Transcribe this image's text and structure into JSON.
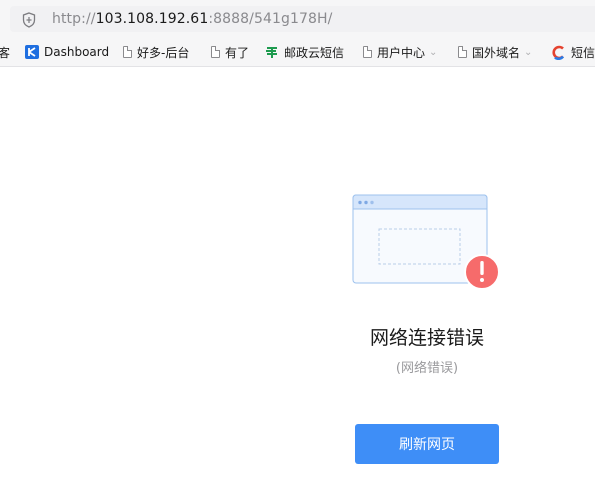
{
  "browser": {
    "url_scheme": "http://",
    "url_host": "103.108.192.61",
    "url_rest": ":8888/541g178H/"
  },
  "bookmarks": {
    "partial_first": "客",
    "items": [
      {
        "label": "Dashboard",
        "icon": "kuaidi-logo-icon"
      },
      {
        "label": "好多-后台",
        "icon": "page-icon"
      },
      {
        "label": "有了",
        "icon": "page-icon"
      },
      {
        "label": "邮政云短信",
        "icon": "china-post-logo-icon"
      },
      {
        "label": "用户中心",
        "icon": "page-icon",
        "folder": true
      },
      {
        "label": "国外域名",
        "icon": "page-icon",
        "folder": true
      },
      {
        "label": "短信",
        "icon": "c-logo-icon"
      }
    ]
  },
  "error": {
    "title": "网络连接错误",
    "subtitle": "(网络错误)",
    "refresh_label": "刷新网页"
  },
  "colors": {
    "accent": "#3e8ef7",
    "error_badge": "#f66b6b",
    "illustration_stroke": "#9ec2ee"
  }
}
